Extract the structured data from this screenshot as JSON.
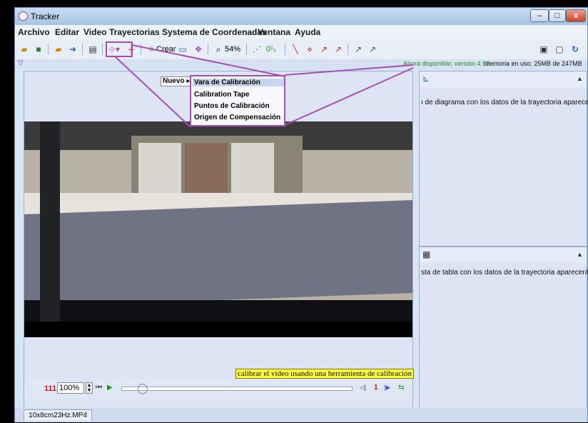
{
  "window": {
    "title": "Tracker"
  },
  "menubar": {
    "items": [
      "Archivo",
      "Editar",
      "Video",
      "Trayectorias",
      "Systema de Coordenadas",
      "Ventana",
      "Ayuda"
    ]
  },
  "toolbar": {
    "create_label": "Crear",
    "zoom_label": "54%",
    "step_label": "0¹₂"
  },
  "info": {
    "update": "Ahora disponible: versión 4.92",
    "memory": "memoria en uso: 25MB de 247MB"
  },
  "new_menu": {
    "trigger": "Nuevo",
    "items": [
      "Vara de Calibración",
      "Calibration Tape",
      "Puntos de Calibración",
      "Origen de Compensación"
    ]
  },
  "video": {
    "hint": "calibrar el video usando una herramienta de calibración"
  },
  "controls": {
    "frame": "111",
    "rate": "100%",
    "step_count": "1"
  },
  "panels": {
    "plot_text": "ı de diagrama con los datos de la trayectoria aparece",
    "table_text": "sta de tabla con los datos de la trayectoria aparecerá"
  },
  "file_tab": "10x8cm23Hz.MP4",
  "colors": {
    "highlight": "#a64fb0",
    "hint_bg": "#ffff40",
    "frame_red": "#d11414"
  }
}
